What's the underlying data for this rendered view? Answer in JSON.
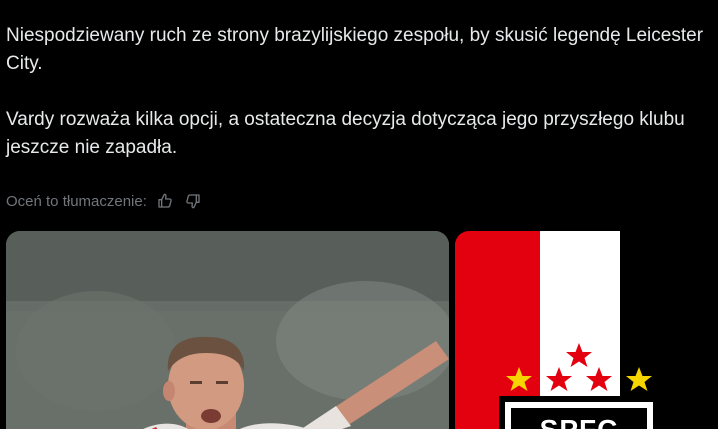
{
  "post": {
    "paragraph_1": "Niespodziewany ruch ze strony brazylijskiego zespołu, by skusić legendę Leicester City.",
    "paragraph_2": "Vardy rozważa kilka opcji, a ostateczna decyzja dotycząca jego przyszłego klubu jeszcze nie zapadła."
  },
  "translation_rating": {
    "label": "Oceń to tłumaczenie:",
    "thumbs_up_icon": "thumbs-up-icon",
    "thumbs_down_icon": "thumbs-down-icon"
  },
  "media": {
    "left_image": "photo of football player in celebration",
    "right_image": "Sao Paulo FC crest with red, white and black stripes and stars"
  },
  "colors": {
    "background": "#000000",
    "text": "#e7e9ea",
    "muted": "#71767b",
    "crest_red": "#e3000f",
    "star_yellow": "#f5d400"
  }
}
